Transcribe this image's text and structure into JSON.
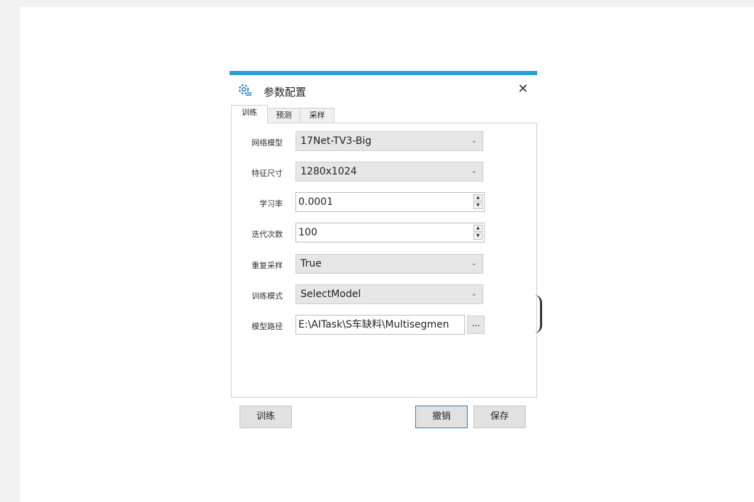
{
  "dialog": {
    "title": "参数配置",
    "close_label": "✕",
    "icon": "settings-gear-icon",
    "accent_color": "#2a9fd6"
  },
  "tabs": [
    {
      "label": "训练",
      "active": true
    },
    {
      "label": "预测",
      "active": false
    },
    {
      "label": "采样",
      "active": false
    }
  ],
  "form": {
    "network_model": {
      "label": "网络模型",
      "value": "17Net-TV3-Big"
    },
    "feature_size": {
      "label": "特征尺寸",
      "value": "1280x1024"
    },
    "learning_rate": {
      "label": "学习率",
      "value": "0.0001"
    },
    "iterations": {
      "label": "迭代次数",
      "value": "100"
    },
    "resample": {
      "label": "重复采样",
      "value": "True"
    },
    "train_mode": {
      "label": "训练模式",
      "value": "SelectModel"
    },
    "model_path": {
      "label": "模型路径",
      "value": "E:\\AITask\\S车缺料\\Multisegmen",
      "browse_label": "..."
    }
  },
  "buttons": {
    "train": "训练",
    "cancel": "撤销",
    "save": "保存"
  }
}
